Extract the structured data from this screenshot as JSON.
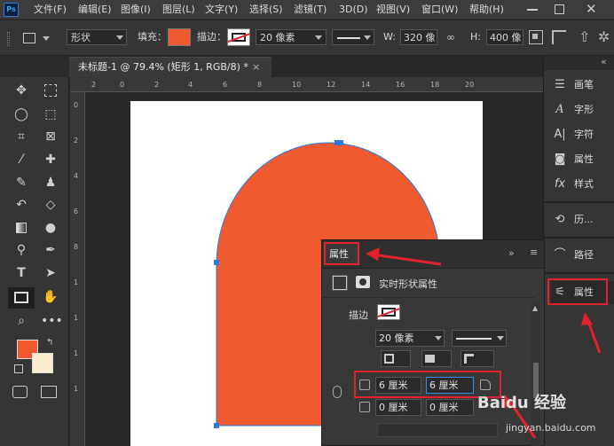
{
  "app": {
    "logo": "Ps"
  },
  "menu": [
    "文件(F)",
    "编辑(E)",
    "图像(I)",
    "图层(L)",
    "文字(Y)",
    "选择(S)",
    "滤镜(T)",
    "3D(D)",
    "视图(V)",
    "窗口(W)",
    "帮助(H)"
  ],
  "options": {
    "mode_value": "形状",
    "fill_label": "填充：",
    "fill_color": "#f15a2e",
    "stroke_label": "描边：",
    "stroke_width": "20 像素",
    "w_label": "W:",
    "w_value": "320 像",
    "h_label": "H:",
    "h_value": "400 像"
  },
  "document": {
    "tab_title": "未标题-1 @ 79.4% (矩形 1, RGB/8) *",
    "close_glyph": "×"
  },
  "rulers": {
    "h_ticks": [
      "2",
      "0",
      "2",
      "4",
      "6",
      "8",
      "10",
      "12",
      "14",
      "16",
      "18",
      "20"
    ],
    "v_ticks": [
      "0",
      "2",
      "4",
      "6",
      "8",
      "1",
      "1",
      "1",
      "1"
    ]
  },
  "shape": {
    "fill": "#f15a2e",
    "handle_color": "#2a7ae2"
  },
  "colors": {
    "foreground": "#f15a2e",
    "background": "#fdeed0"
  },
  "dock": {
    "collapse_glyph": "«",
    "items": [
      {
        "icon": "brush-icon",
        "label": "画笔"
      },
      {
        "icon": "character-icon",
        "label": "字形"
      },
      {
        "icon": "paragraph-icon",
        "label": "字符"
      },
      {
        "icon": "properties-icon",
        "label": "属性"
      },
      {
        "icon": "fx-icon",
        "label": "样式"
      },
      {
        "icon": "history-icon",
        "label": "历..."
      },
      {
        "icon": "paths-icon",
        "label": "路径"
      },
      {
        "icon": "adjust-icon",
        "label": "属性"
      }
    ]
  },
  "properties": {
    "tab_label": "属性",
    "collapse_glyph": "»",
    "menu_glyph": "≡",
    "live_shape_label": "实时形状属性",
    "stroke_label": "描边",
    "stroke_width": "20 像素",
    "corner_tl": "6 厘米",
    "corner_tr": "6 厘米",
    "corner_bl": "0 厘米",
    "corner_br": "0 厘米"
  },
  "watermark": {
    "brand": "Baidu 经验",
    "url": "jingyan.baidu.com"
  }
}
